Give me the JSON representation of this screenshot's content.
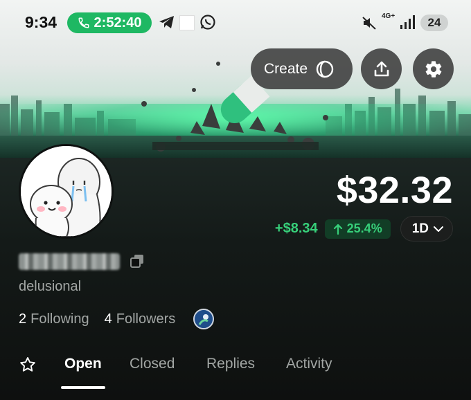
{
  "status_bar": {
    "time": "9:34",
    "call_timer": "2:52:40",
    "network_label": "4G+",
    "badge_count": "24",
    "icons": [
      "phone-icon",
      "telegram-icon",
      "blank-square-icon",
      "whatsapp-icon",
      "mute-icon",
      "signal-icon"
    ]
  },
  "header": {
    "create_label": "Create",
    "share_icon": "upload-icon",
    "settings_icon": "gear-icon"
  },
  "profile": {
    "balance": "$32.32",
    "change_abs": "+$8.34",
    "change_pct": "25.4%",
    "range": "1D",
    "bio": "delusional",
    "following_count": "2",
    "following_label": "Following",
    "followers_count": "4",
    "followers_label": "Followers"
  },
  "tabs": [
    {
      "label": "Open",
      "active": true
    },
    {
      "label": "Closed",
      "active": false
    },
    {
      "label": "Replies",
      "active": false
    },
    {
      "label": "Activity",
      "active": false
    }
  ],
  "colors": {
    "positive": "#37d07a",
    "call_green": "#1eb863",
    "background": "#0d0f0e"
  }
}
